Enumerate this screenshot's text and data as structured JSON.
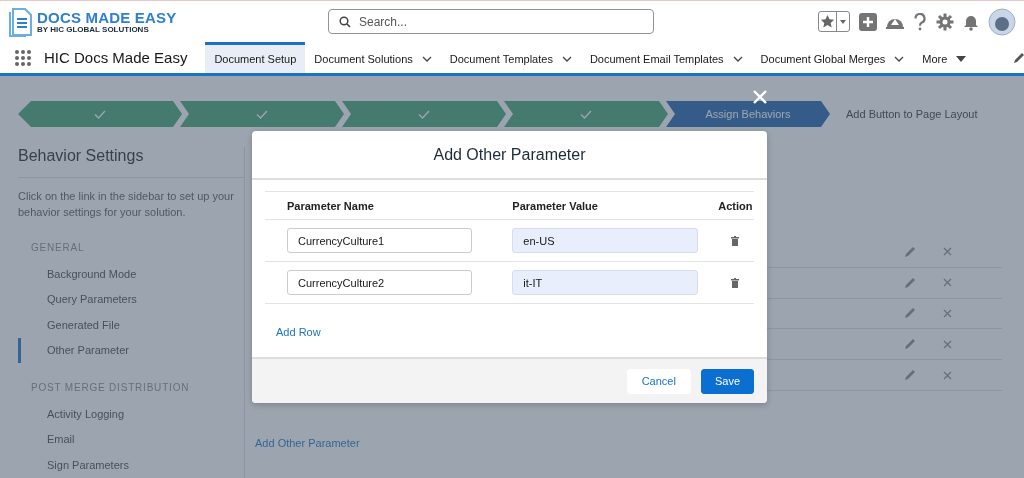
{
  "header": {
    "logo_title": "DOCS MADE EASY",
    "logo_subtitle": "BY HIC GLOBAL SOLUTIONS",
    "search": {
      "placeholder": "Search..."
    }
  },
  "nav": {
    "app_name": "HIC Docs Made Easy",
    "tabs": [
      {
        "label": "Document Setup",
        "selected": true,
        "kind": "plain"
      },
      {
        "label": "Document Solutions",
        "selected": false,
        "kind": "dropdown"
      },
      {
        "label": "Document Templates",
        "selected": false,
        "kind": "dropdown"
      },
      {
        "label": "Document Email Templates",
        "selected": false,
        "kind": "dropdown"
      },
      {
        "label": "Document Global Merges",
        "selected": false,
        "kind": "dropdown"
      },
      {
        "label": "More",
        "selected": false,
        "kind": "overflow"
      }
    ]
  },
  "stepper": [
    {
      "completed": true,
      "current": false
    },
    {
      "completed": true,
      "current": false
    },
    {
      "completed": true,
      "current": false
    },
    {
      "completed": true,
      "current": false
    },
    {
      "label": "Assign Behaviors",
      "completed": false,
      "current": true
    },
    {
      "label": "Add Button to Page Layout",
      "completed": false,
      "current": false
    }
  ],
  "sidebar": {
    "title": "Behavior Settings",
    "description": "Click on the link in the sidebar to set up your behavior settings for your solution.",
    "sections": [
      {
        "heading": "GENERAL",
        "items": [
          {
            "label": "Background Mode",
            "selected": false
          },
          {
            "label": "Query Parameters",
            "selected": false
          },
          {
            "label": "Generated File",
            "selected": false
          },
          {
            "label": "Other Parameter",
            "selected": true
          }
        ]
      },
      {
        "heading": "POST MERGE DISTRIBUTION",
        "items": [
          {
            "label": "Activity Logging",
            "selected": false
          },
          {
            "label": "Email",
            "selected": false
          },
          {
            "label": "Sign Parameters",
            "selected": false
          }
        ]
      }
    ]
  },
  "content": {
    "add_link": "Add Other Parameter"
  },
  "modal": {
    "title": "Add Other Parameter",
    "columns": [
      "Parameter Name",
      "Parameter Value",
      "Action"
    ],
    "rows": [
      {
        "name": "CurrencyCulture1",
        "value": "en-US"
      },
      {
        "name": "CurrencyCulture2",
        "value": "it-IT"
      }
    ],
    "add_row": "Add Row",
    "buttons": [
      {
        "label": "Cancel",
        "kind": "neutral"
      },
      {
        "label": "Save",
        "kind": "brand"
      }
    ]
  }
}
